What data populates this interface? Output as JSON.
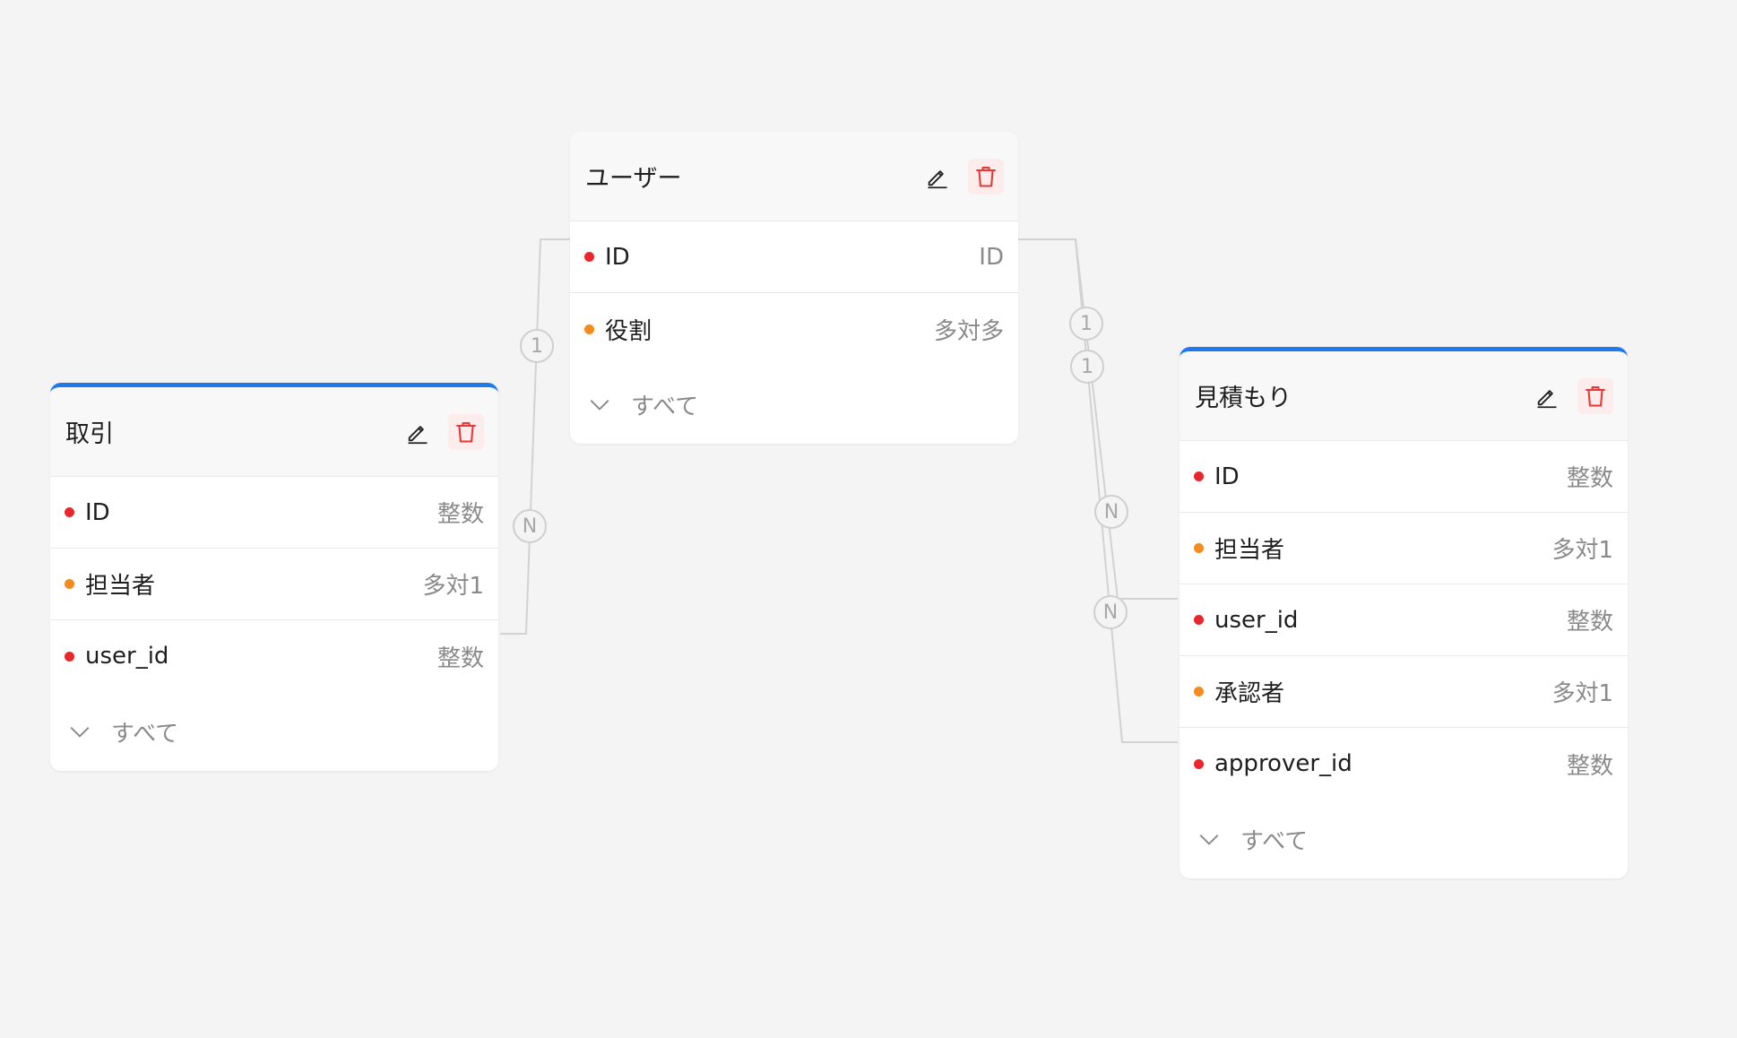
{
  "colors": {
    "primary_key": "#e8262c",
    "relation": "#f58a1f",
    "accent": "#1f7aec",
    "delete": "#e53935"
  },
  "tables": {
    "torihiki": {
      "title": "取引",
      "fields": [
        {
          "name": "ID",
          "type": "整数",
          "kind": "primary_key"
        },
        {
          "name": "担当者",
          "type": "多対1",
          "kind": "relation"
        },
        {
          "name": "user_id",
          "type": "整数",
          "kind": "primary_key"
        }
      ],
      "footer": "すべて"
    },
    "user": {
      "title": "ユーザー",
      "fields": [
        {
          "name": "ID",
          "type": "ID",
          "kind": "primary_key"
        },
        {
          "name": "役割",
          "type": "多対多",
          "kind": "relation"
        }
      ],
      "footer": "すべて"
    },
    "mitsumori": {
      "title": "見積もり",
      "fields": [
        {
          "name": "ID",
          "type": "整数",
          "kind": "primary_key"
        },
        {
          "name": "担当者",
          "type": "多対1",
          "kind": "relation"
        },
        {
          "name": "user_id",
          "type": "整数",
          "kind": "primary_key"
        },
        {
          "name": "承認者",
          "type": "多対1",
          "kind": "relation"
        },
        {
          "name": "approver_id",
          "type": "整数",
          "kind": "primary_key"
        }
      ],
      "footer": "すべて"
    }
  },
  "relations": {
    "torihiki_user": {
      "one": "1",
      "many": "N"
    },
    "mitsumori_user_a": {
      "one": "1",
      "many": "N"
    },
    "mitsumori_user_b": {
      "one": "1",
      "many": "N"
    }
  }
}
